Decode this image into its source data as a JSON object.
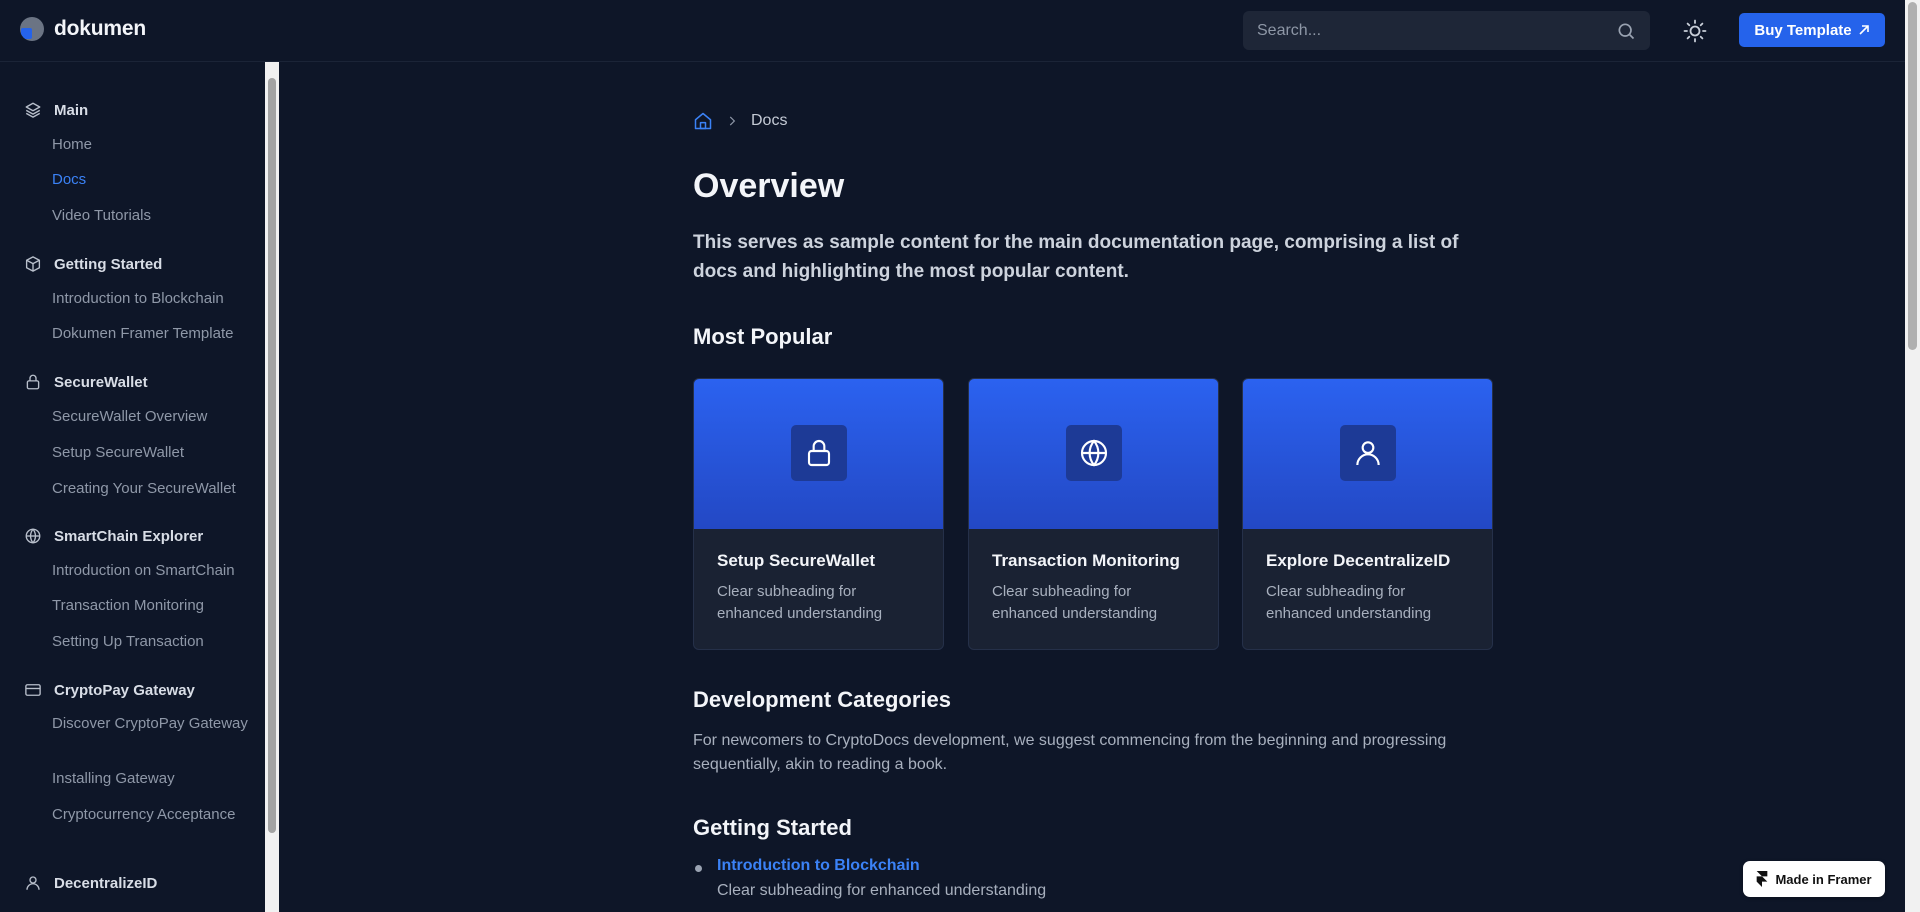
{
  "header": {
    "brand": "dokumen",
    "search_placeholder": "Search...",
    "buy_label": "Buy Template"
  },
  "sidebar": {
    "groups": [
      {
        "title": "Main",
        "icon": "layers-icon",
        "items": [
          "Home",
          "Docs",
          "Video Tutorials"
        ],
        "active": "Docs"
      },
      {
        "title": "Getting Started",
        "icon": "box-icon",
        "items": [
          "Introduction to Blockchain",
          "Dokumen Framer Template"
        ]
      },
      {
        "title": "SecureWallet",
        "icon": "lock-icon",
        "items": [
          "SecureWallet Overview",
          "Setup SecureWallet",
          "Creating Your SecureWallet"
        ]
      },
      {
        "title": "SmartChain Explorer",
        "icon": "globe-icon",
        "items": [
          "Introduction on SmartChain",
          "Transaction Monitoring",
          "Setting Up Transaction"
        ]
      },
      {
        "title": "CryptoPay Gateway",
        "icon": "credit-card-icon",
        "items": [
          "Discover CryptoPay Gateway",
          "Installing Gateway",
          "Cryptocurrency Acceptance"
        ]
      },
      {
        "title": "DecentralizeID",
        "icon": "user-icon",
        "items": []
      }
    ]
  },
  "breadcrumb": {
    "current": "Docs"
  },
  "main": {
    "title": "Overview",
    "description": "This serves as sample content for the main documentation page, comprising a list of docs and highlighting the most popular content.",
    "most_popular_heading": "Most Popular",
    "cards": [
      {
        "title": "Setup SecureWallet",
        "subtitle": "Clear subheading for enhanced understanding",
        "icon": "lock-icon"
      },
      {
        "title": "Transaction Monitoring",
        "subtitle": "Clear subheading for enhanced understanding",
        "icon": "globe-icon"
      },
      {
        "title": "Explore DecentralizeID",
        "subtitle": "Clear subheading for enhanced understanding",
        "icon": "user-icon"
      }
    ],
    "dev_heading": "Development Categories",
    "dev_description": "For newcomers to CryptoDocs development, we suggest commencing from the beginning and progressing sequentially, akin to reading a book.",
    "getting_started_heading": "Getting Started",
    "getting_started_items": [
      {
        "title": "Introduction to Blockchain",
        "subtitle": "Clear subheading for enhanced understanding"
      }
    ]
  },
  "framer_badge": "Made in Framer",
  "colors": {
    "background": "#0e1628",
    "accent": "#2563eb",
    "link": "#3b82f6"
  }
}
